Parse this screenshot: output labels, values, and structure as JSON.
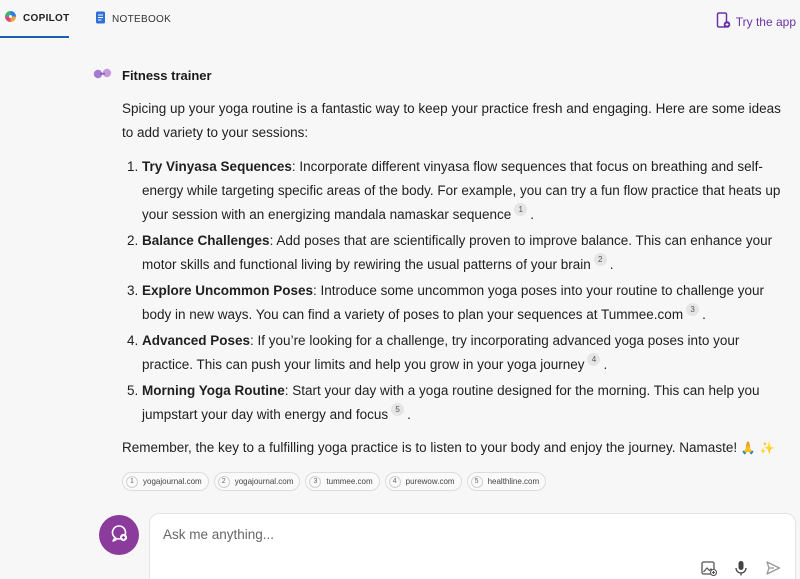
{
  "tabs": [
    {
      "label": "COPILOT",
      "icon": "copilot-logo-icon",
      "active": true
    },
    {
      "label": "NOTEBOOK",
      "icon": "notebook-icon",
      "active": false
    }
  ],
  "try_app": {
    "label": "Try the app",
    "icon": "phone-app-icon"
  },
  "persona": {
    "name": "Fitness trainer",
    "icon": "dumbbell-icon"
  },
  "response": {
    "intro": "Spicing up your yoga routine is a fantastic way to keep your practice fresh and engaging. Here are some ideas to add variety to your sessions:",
    "items": [
      {
        "title": "Try Vinyasa Sequences",
        "text": ": Incorporate different vinyasa flow sequences that focus on breathing and self-energy while targeting specific areas of the body. For example, you can try a fun flow practice that heats up your session with an energizing mandala namaskar sequence",
        "cite": "1",
        "end": "."
      },
      {
        "title": "Balance Challenges",
        "text": ": Add poses that are scientifically proven to improve balance. This can enhance your motor skills and functional living by rewiring the usual patterns of your brain",
        "cite": "2",
        "end": "."
      },
      {
        "title": "Explore Uncommon Poses",
        "text": ": Introduce some uncommon yoga poses into your routine to challenge your body in new ways. You can find a variety of poses to plan your sequences at Tummee.com",
        "cite": "3",
        "end": "."
      },
      {
        "title": "Advanced Poses",
        "text": ": If you’re looking for a challenge, try incorporating advanced yoga poses into your practice. This can push your limits and help you grow in your yoga journey",
        "cite": "4",
        "end": "."
      },
      {
        "title": "Morning Yoga Routine",
        "text": ": Start your day with a yoga routine designed for the morning. This can help you jumpstart your day with energy and focus",
        "cite": "5",
        "end": "."
      }
    ],
    "outro": "Remember, the key to a fulfilling yoga practice is to listen to your body and enjoy the journey. Namaste!",
    "outro_emoji": "🙏 ✨"
  },
  "sources": [
    {
      "num": "1",
      "label": "yogajournal.com"
    },
    {
      "num": "2",
      "label": "yogajournal.com"
    },
    {
      "num": "3",
      "label": "tummee.com"
    },
    {
      "num": "4",
      "label": "purewow.com"
    },
    {
      "num": "5",
      "label": "healthline.com"
    }
  ],
  "input": {
    "placeholder": "Ask me anything...",
    "value": "",
    "icons": [
      "image-add-icon",
      "microphone-icon",
      "send-icon"
    ]
  },
  "new_topic_icon": "new-topic-icon",
  "colors": {
    "accent": "#1a5fb4",
    "brand_purple": "#6b33a8",
    "new_topic_bg": "#8a3b9b"
  }
}
